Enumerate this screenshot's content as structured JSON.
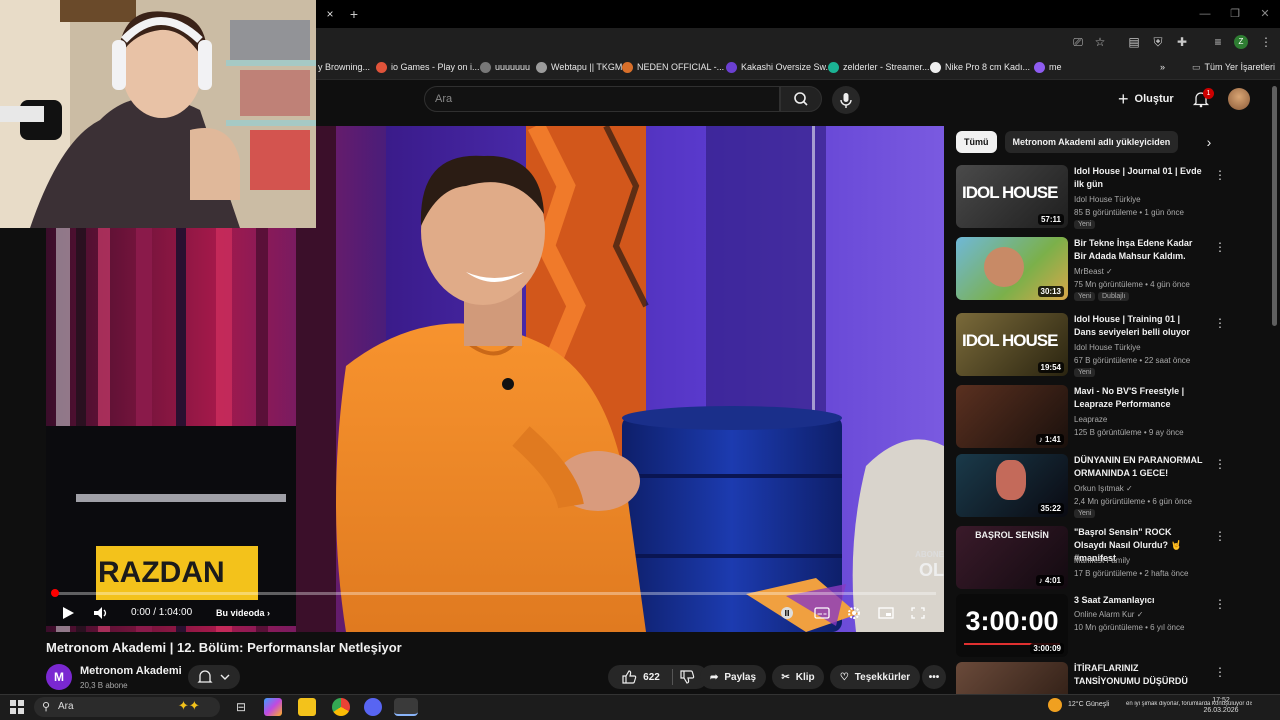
{
  "browser": {
    "tab_close": "×",
    "new_tab": "+",
    "bookmarks": [
      {
        "label": "y Browning...",
        "color": "#00000000"
      },
      {
        "label": "io Games - Play on i...",
        "color": "#e0533a"
      },
      {
        "label": "uuuuuuu",
        "color": "#777777"
      },
      {
        "label": "Webtapu || TKGM",
        "color": "#9b9b9b"
      },
      {
        "label": "NEDEN OFFICIAL -...",
        "color": "#d86f2a"
      },
      {
        "label": "Kakashi Oversize Sw...",
        "color": "#6b3fd1"
      },
      {
        "label": "zelderler - Streamer...",
        "color": "#1bb394"
      },
      {
        "label": "Nike Pro 8 cm Kadı...",
        "color": "#eeeeee"
      },
      {
        "label": "me",
        "color": "#8e5cf0"
      }
    ],
    "bookmarks_overflow": "»",
    "all_bookmarks": "Tüm Yer İşaretleri"
  },
  "youtube": {
    "search_placeholder": "Ara",
    "create_label": "Oluştur",
    "notification_count": "1"
  },
  "player": {
    "overlay_text": "RAZDAN",
    "abone_label": "ABONE",
    "ol_label": "OL",
    "time": "0:00 / 1:04:00",
    "chapter": "Bu videoda",
    "progress": 0.0
  },
  "video": {
    "title": "Metronom Akademi | 12. Bölüm: Performanslar Netleşiyor",
    "channel": "Metronom Akademi",
    "subscribers": "20,3 B abone",
    "likes": "622",
    "share": "Paylaş",
    "clip": "Klip",
    "thanks": "Teşekkürler",
    "more": "•••"
  },
  "sidebar": {
    "chips": [
      "Tümü",
      "Metronom Akademi adlı yükleyiciden"
    ],
    "recommendations": [
      {
        "title": "Idol House | Journal 01 | Evde ilk gün",
        "channel": "Idol House Türkiye",
        "meta": "85 B görüntüleme • 1 gün önce",
        "badge": "Yeni",
        "duration": "57:11",
        "thumb_text": "IDOL HOUSE"
      },
      {
        "title": "Bir Tekne İnşa Edene Kadar Bir Adada Mahsur Kaldım.",
        "channel": "MrBeast",
        "meta": "75 Mn görüntüleme • 4 gün önce",
        "badge": "Yeni",
        "badge2": "Dublajlı",
        "duration": "30:13",
        "thumb_text": ""
      },
      {
        "title": "Idol House | Training 01 | Dans seviyeleri belli oluyor",
        "channel": "Idol House Türkiye",
        "meta": "67 B görüntüleme • 22 saat önce",
        "badge": "Yeni",
        "duration": "19:54",
        "thumb_text": "IDOL HOUSE"
      },
      {
        "title": "Mavi - No BV'S Freestyle | Leapraze Performance",
        "channel": "Leapraze",
        "meta": "125 B görüntüleme • 9 ay önce",
        "duration": "1:41",
        "thumb_text": ""
      },
      {
        "title": "DÜNYANIN EN PARANORMAL ORMANINDA 1 GECE!",
        "channel": "Orkun Işıtmak",
        "meta": "2,4 Mn görüntüleme • 6 gün önce",
        "badge": "Yeni",
        "duration": "35:22",
        "thumb_text": ""
      },
      {
        "title": "\"Başrol Sensin\" ROCK Olsaydı Nasıl Olurdu? 🤘 #manifest",
        "channel": "Manifest Family",
        "meta": "17 B görüntüleme • 2 hafta önce",
        "duration": "4:01",
        "thumb_text": "BAŞROL SENSİN"
      },
      {
        "title": "3 Saat Zamanlayıcı",
        "channel": "Online Alarm Kur",
        "meta": "10 Mn görüntüleme • 6 yıl önce",
        "duration": "3:00:09",
        "thumb_text": "3:00:00"
      },
      {
        "title": "İTİRAFLARINIZ TANSİYONUMU DÜŞÜRDÜ",
        "channel": "",
        "meta": "",
        "duration": "",
        "thumb_text": ""
      }
    ]
  },
  "taskbar": {
    "search": "Ara",
    "weather": "12°C Güneşli",
    "ticker": "en iyi şimak diyorlar, forumlarda konuşuluyor dışarda",
    "time": "17:52",
    "date": "26.03.2026"
  },
  "colors": {
    "accent_red": "#ff0000",
    "yt_bg": "#0f0f0f",
    "razdan_yellow": "#f3c21b",
    "shirt_orange": "#f08a2c"
  }
}
